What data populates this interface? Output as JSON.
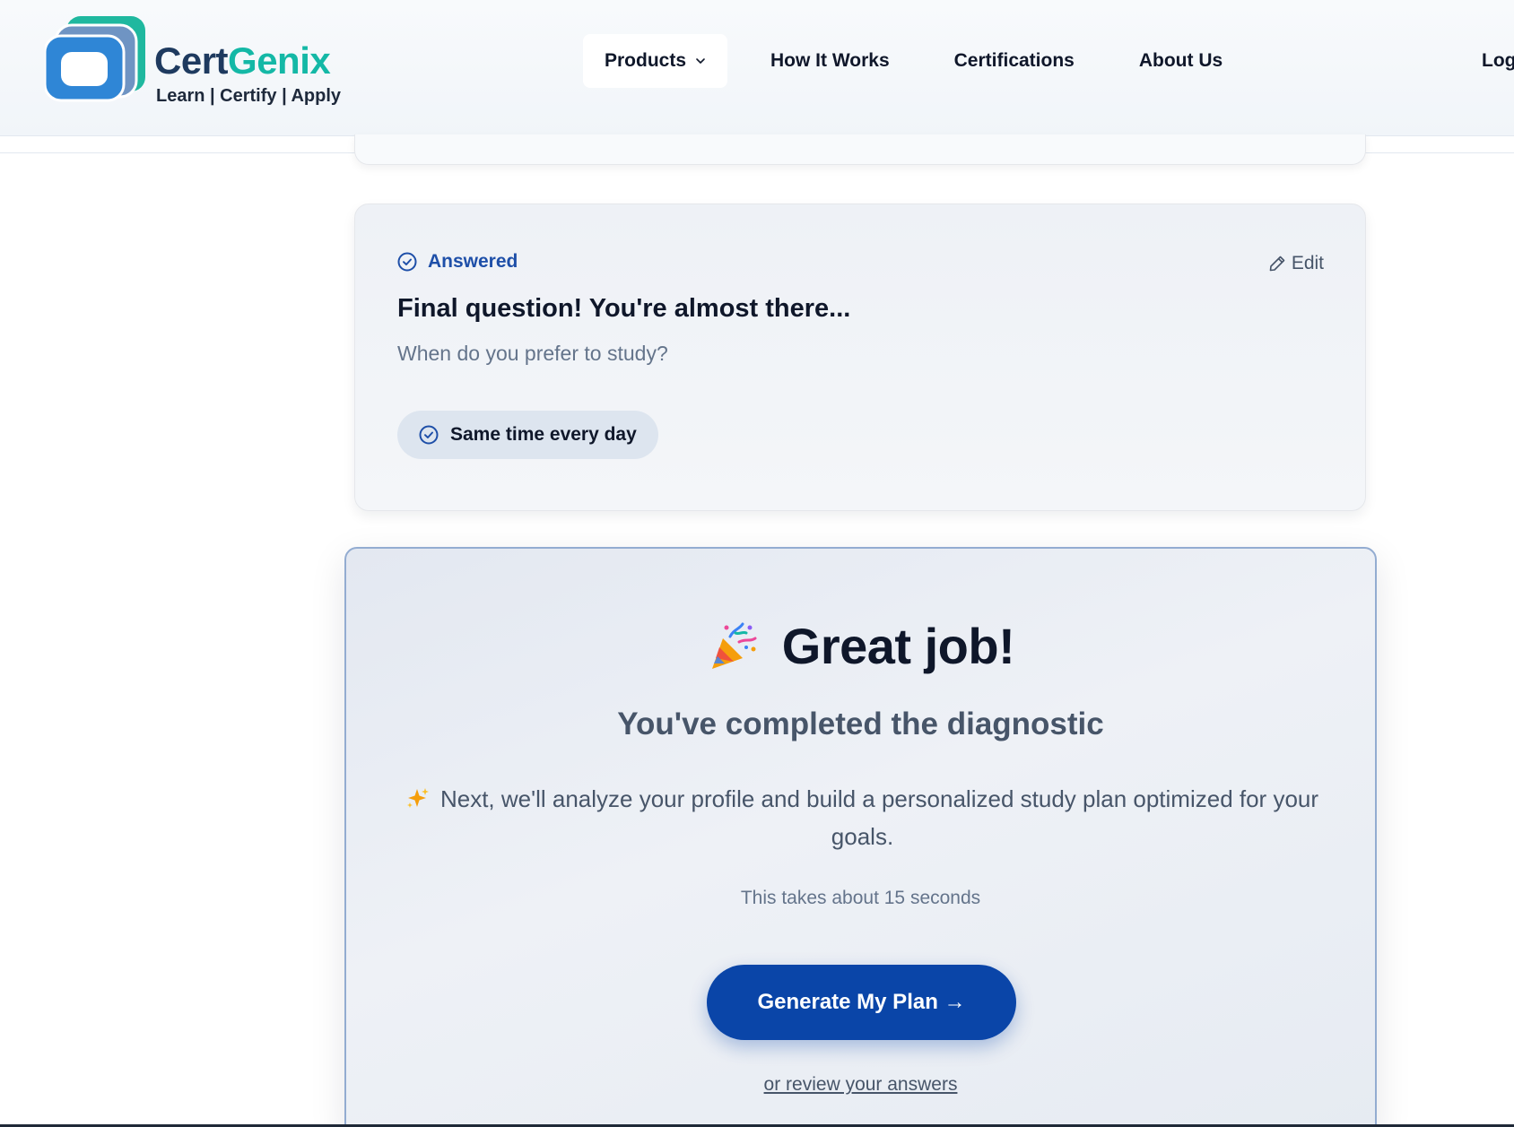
{
  "header": {
    "brand_name_part1": "Cert",
    "brand_name_part2": "Genix",
    "tagline": "Learn | Certify | Apply",
    "nav": [
      {
        "label": "Products",
        "has_dropdown": true,
        "active": true
      },
      {
        "label": "How It Works"
      },
      {
        "label": "Certifications"
      },
      {
        "label": "About Us"
      }
    ],
    "login_label": "Log"
  },
  "question_card": {
    "status": "Answered",
    "edit_label": "Edit",
    "title": "Final question! You're almost there...",
    "question": "When do you prefer to study?",
    "answer": "Same time every day"
  },
  "completion": {
    "headline": "Great job!",
    "subheadline": "You've completed the diagnostic",
    "description": "Next, we'll analyze your profile and build a personalized study plan optimized for your goals.",
    "duration_note": "This takes about 15 seconds",
    "cta_label": "Generate My Plan →",
    "review_link": "or review your answers"
  },
  "colors": {
    "primary": "#0a45a8",
    "brand_teal": "#14b8a6",
    "brand_navy": "#1e3a5f",
    "status_blue": "#1e4fa8"
  },
  "icons": [
    "logo-icon",
    "chevron-down-icon",
    "check-circle-icon",
    "pencil-icon",
    "party-popper-icon",
    "sparkles-icon"
  ]
}
